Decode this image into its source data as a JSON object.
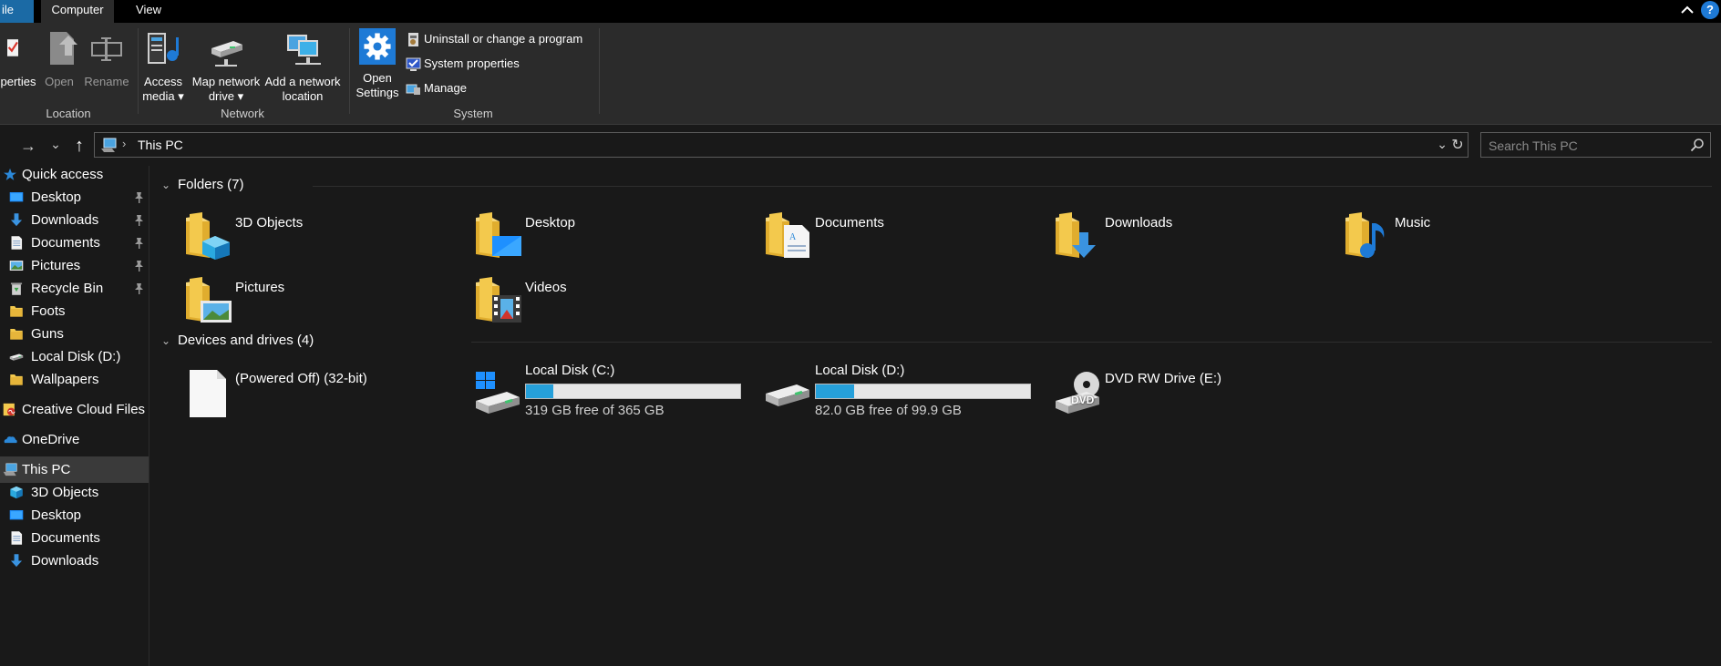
{
  "tabs": {
    "file": "ile",
    "computer": "Computer",
    "view": "View",
    "help": "?"
  },
  "ribbon": {
    "location": {
      "label": "Location",
      "properties": "perties",
      "open": "Open",
      "rename": "Rename"
    },
    "network": {
      "label": "Network",
      "access_media_1": "Access",
      "access_media_2": "media ▾",
      "map_drive_1": "Map network",
      "map_drive_2": "drive ▾",
      "add_location_1": "Add a network",
      "add_location_2": "location"
    },
    "system": {
      "label": "System",
      "open_settings_1": "Open",
      "open_settings_2": "Settings",
      "uninstall": "Uninstall or change a program",
      "system_properties": "System properties",
      "manage": "Manage"
    }
  },
  "nav": {
    "forward": "→",
    "recent": "⌄",
    "up": "↑",
    "path_sep": "›",
    "address": "This PC",
    "dropdown": "⌄",
    "refresh": "↻",
    "search_placeholder": "Search This PC"
  },
  "sidebar": [
    {
      "label": "Quick access",
      "icon": "star-icon",
      "pinned": false
    },
    {
      "label": "Desktop",
      "icon": "desktop-icon",
      "pinned": true
    },
    {
      "label": "Downloads",
      "icon": "download-icon",
      "pinned": true
    },
    {
      "label": "Documents",
      "icon": "document-icon",
      "pinned": true
    },
    {
      "label": "Pictures",
      "icon": "pictures-icon",
      "pinned": true
    },
    {
      "label": "Recycle Bin",
      "icon": "recycle-bin-icon",
      "pinned": true
    },
    {
      "label": "Foots",
      "icon": "folder-icon",
      "pinned": false
    },
    {
      "label": "Guns",
      "icon": "folder-icon",
      "pinned": false
    },
    {
      "label": "Local Disk (D:)",
      "icon": "drive-icon",
      "pinned": false
    },
    {
      "label": "Wallpapers",
      "icon": "folder-icon",
      "pinned": false
    },
    {
      "label": "Creative Cloud Files",
      "icon": "creative-cloud-icon",
      "pinned": false
    },
    {
      "label": "OneDrive",
      "icon": "onedrive-icon",
      "pinned": false
    },
    {
      "label": "This PC",
      "icon": "this-pc-icon",
      "pinned": false,
      "selected": true
    },
    {
      "label": "3D Objects",
      "icon": "3d-objects-icon",
      "pinned": false
    },
    {
      "label": "Desktop",
      "icon": "desktop-icon",
      "pinned": false
    },
    {
      "label": "Documents",
      "icon": "document-icon",
      "pinned": false
    },
    {
      "label": "Downloads",
      "icon": "download-icon",
      "pinned": false
    }
  ],
  "folders": {
    "header": "Folders (7)",
    "items": [
      {
        "name": "3D Objects",
        "icon": "folder-3d-objects-icon"
      },
      {
        "name": "Desktop",
        "icon": "folder-desktop-icon"
      },
      {
        "name": "Documents",
        "icon": "folder-documents-icon"
      },
      {
        "name": "Downloads",
        "icon": "folder-downloads-icon"
      },
      {
        "name": "Music",
        "icon": "folder-music-icon"
      },
      {
        "name": "Pictures",
        "icon": "folder-pictures-icon"
      },
      {
        "name": "Videos",
        "icon": "folder-videos-icon"
      }
    ]
  },
  "drives": {
    "header": "Devices and drives (4)",
    "items": [
      {
        "name": "(Powered Off) (32-bit)",
        "icon": "blank-file-icon"
      },
      {
        "name": "Local Disk (C:)",
        "free": "319 GB free of 365 GB",
        "used_fraction": 0.126,
        "icon": "windows-drive-icon"
      },
      {
        "name": "Local Disk (D:)",
        "free": "82.0 GB free of 99.9 GB",
        "used_fraction": 0.179,
        "icon": "drive-icon"
      },
      {
        "name": "DVD RW Drive (E:)",
        "icon": "dvd-drive-icon",
        "dvd_label": "DVD"
      }
    ]
  },
  "colors": {
    "accent": "#1e7ad6",
    "folder": "#f3c94d",
    "bar_fill": "#26a0da",
    "background": "#191919"
  }
}
